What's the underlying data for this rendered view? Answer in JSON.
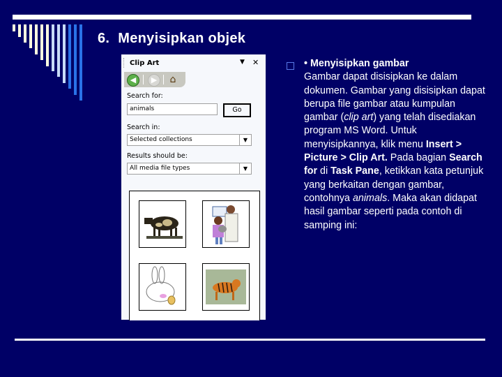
{
  "slide": {
    "title_number": "6.",
    "title_text": "Menyisipkan objek"
  },
  "clip_art_pane": {
    "title": "Clip Art",
    "menu_icon": "dropdown-triangle-icon",
    "close_icon": "close-x-icon",
    "nav": {
      "back_icon": "back-arrow-icon",
      "forward_icon": "forward-arrow-icon",
      "home_icon": "home-icon"
    },
    "search_for_label": "Search for:",
    "search_value": "animals",
    "go_label": "Go",
    "search_in_label": "Search in:",
    "search_in_value": "Selected collections",
    "results_label": "Results should be:",
    "results_value": "All media file types",
    "results_items": [
      {
        "name": "cow"
      },
      {
        "name": "veterinarian-with-girl-and-cat"
      },
      {
        "name": "rabbit-with-egg"
      },
      {
        "name": "tiger"
      }
    ]
  },
  "bullet": {
    "marker_icon": "hollow-square-bullet-icon",
    "heading": "• Menyisipkan gambar",
    "p1": "Gambar dapat disisipkan ke dalam dokumen. Gambar yang disisipkan dapat berupa file gambar atau kumpulan gambar (",
    "p1_italic": "clip art",
    "p2": ") yang telah disediakan program MS Word. Untuk menyisipkannya, klik menu ",
    "p2_bold": "Insert > Picture > Clip Art.",
    "p3": " Pada bagian ",
    "p3_bold": "Search for",
    "p4": " di ",
    "p4_bold": "Task Pane",
    "p5": ", ketikkan kata petunjuk yang berkaitan dengan gambar, contohnya ",
    "p5_italic": "animals",
    "p6": ". Maka akan didapat hasil gambar seperti pada contoh di samping ini:"
  },
  "colors": {
    "background": "#000066",
    "title": "#ffffff",
    "bar_cream": "#fffde0",
    "bar_light_blue": "#c8dcf8",
    "bar_blue": "#2a72e8"
  }
}
